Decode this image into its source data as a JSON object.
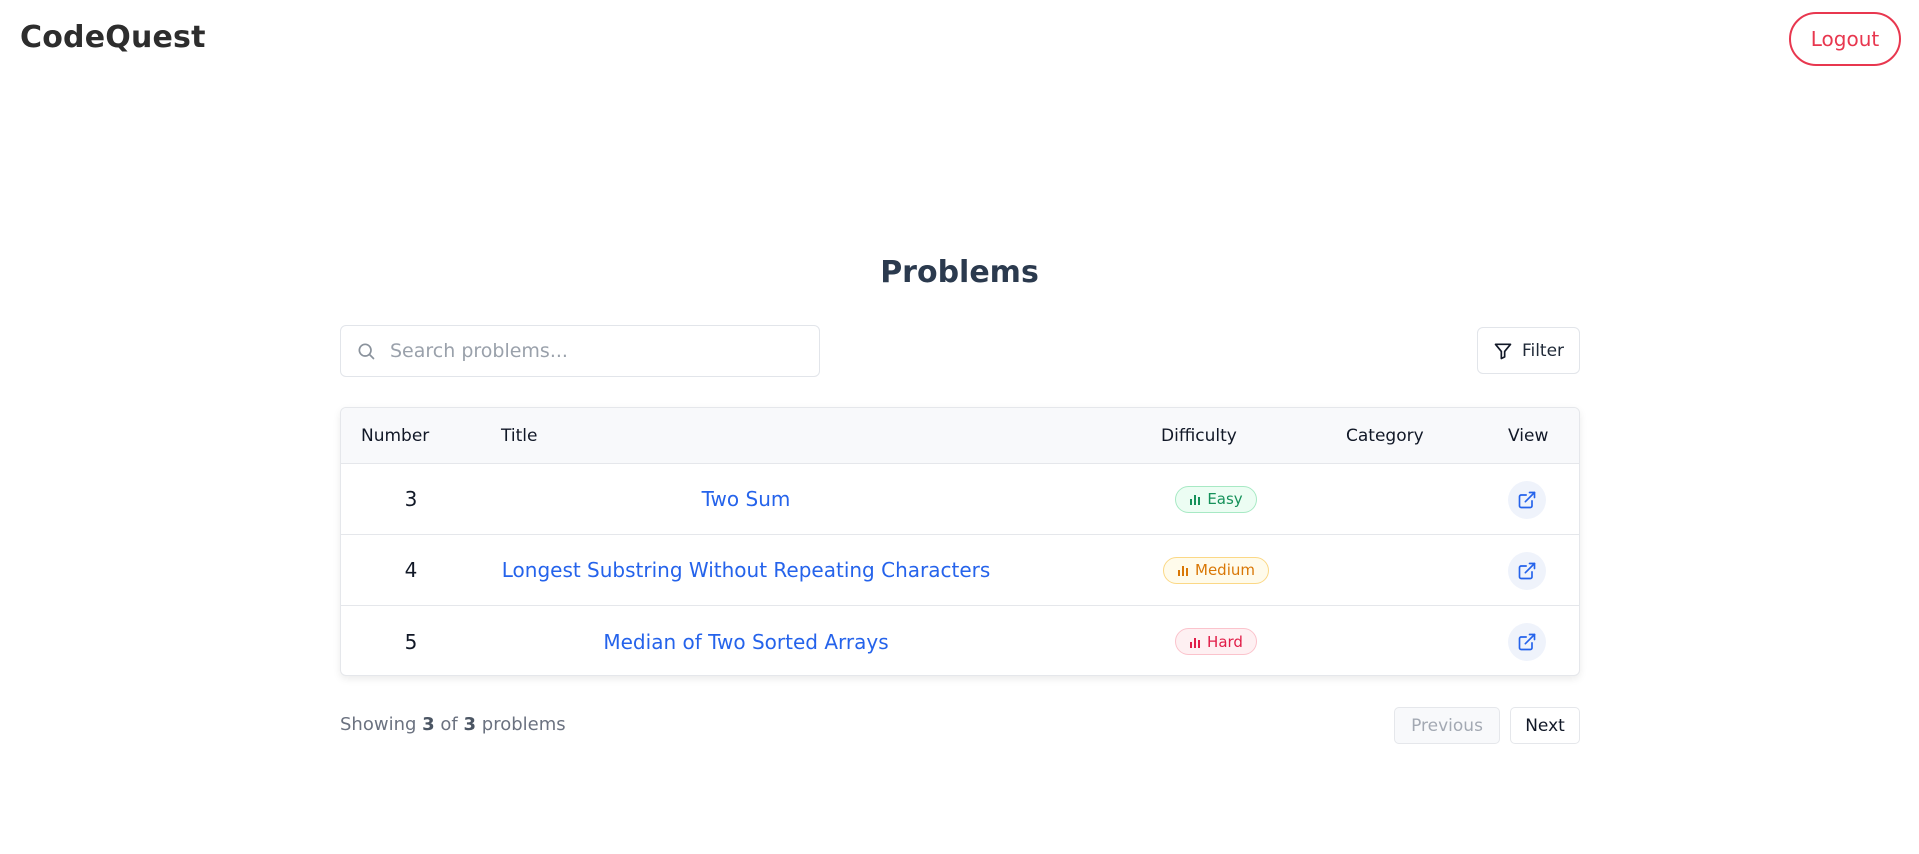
{
  "header": {
    "brand": "CodeQuest",
    "logout_label": "Logout"
  },
  "page_title": "Problems",
  "search": {
    "placeholder": "Search problems...",
    "value": ""
  },
  "filter_label": "Filter",
  "table": {
    "columns": [
      "Number",
      "Title",
      "Difficulty",
      "Category",
      "View"
    ],
    "rows": [
      {
        "number": "3",
        "title": "Two Sum",
        "difficulty": "Easy",
        "category": ""
      },
      {
        "number": "4",
        "title": "Longest Substring Without Repeating Characters",
        "difficulty": "Medium",
        "category": ""
      },
      {
        "number": "5",
        "title": "Median of Two Sorted Arrays",
        "difficulty": "Hard",
        "category": ""
      }
    ]
  },
  "footer": {
    "showing_prefix": "Showing",
    "shown": "3",
    "of_word": "of",
    "total": "3",
    "suffix": "problems",
    "previous_label": "Previous",
    "next_label": "Next"
  },
  "colors": {
    "accent_red": "#e8374f",
    "link_blue": "#2563eb",
    "easy": "#15915a",
    "medium": "#d97706",
    "hard": "#e11d48"
  },
  "icons": {
    "search": "search-icon",
    "filter": "filter-icon",
    "difficulty": "bar-chart-icon",
    "view": "external-link-icon"
  }
}
